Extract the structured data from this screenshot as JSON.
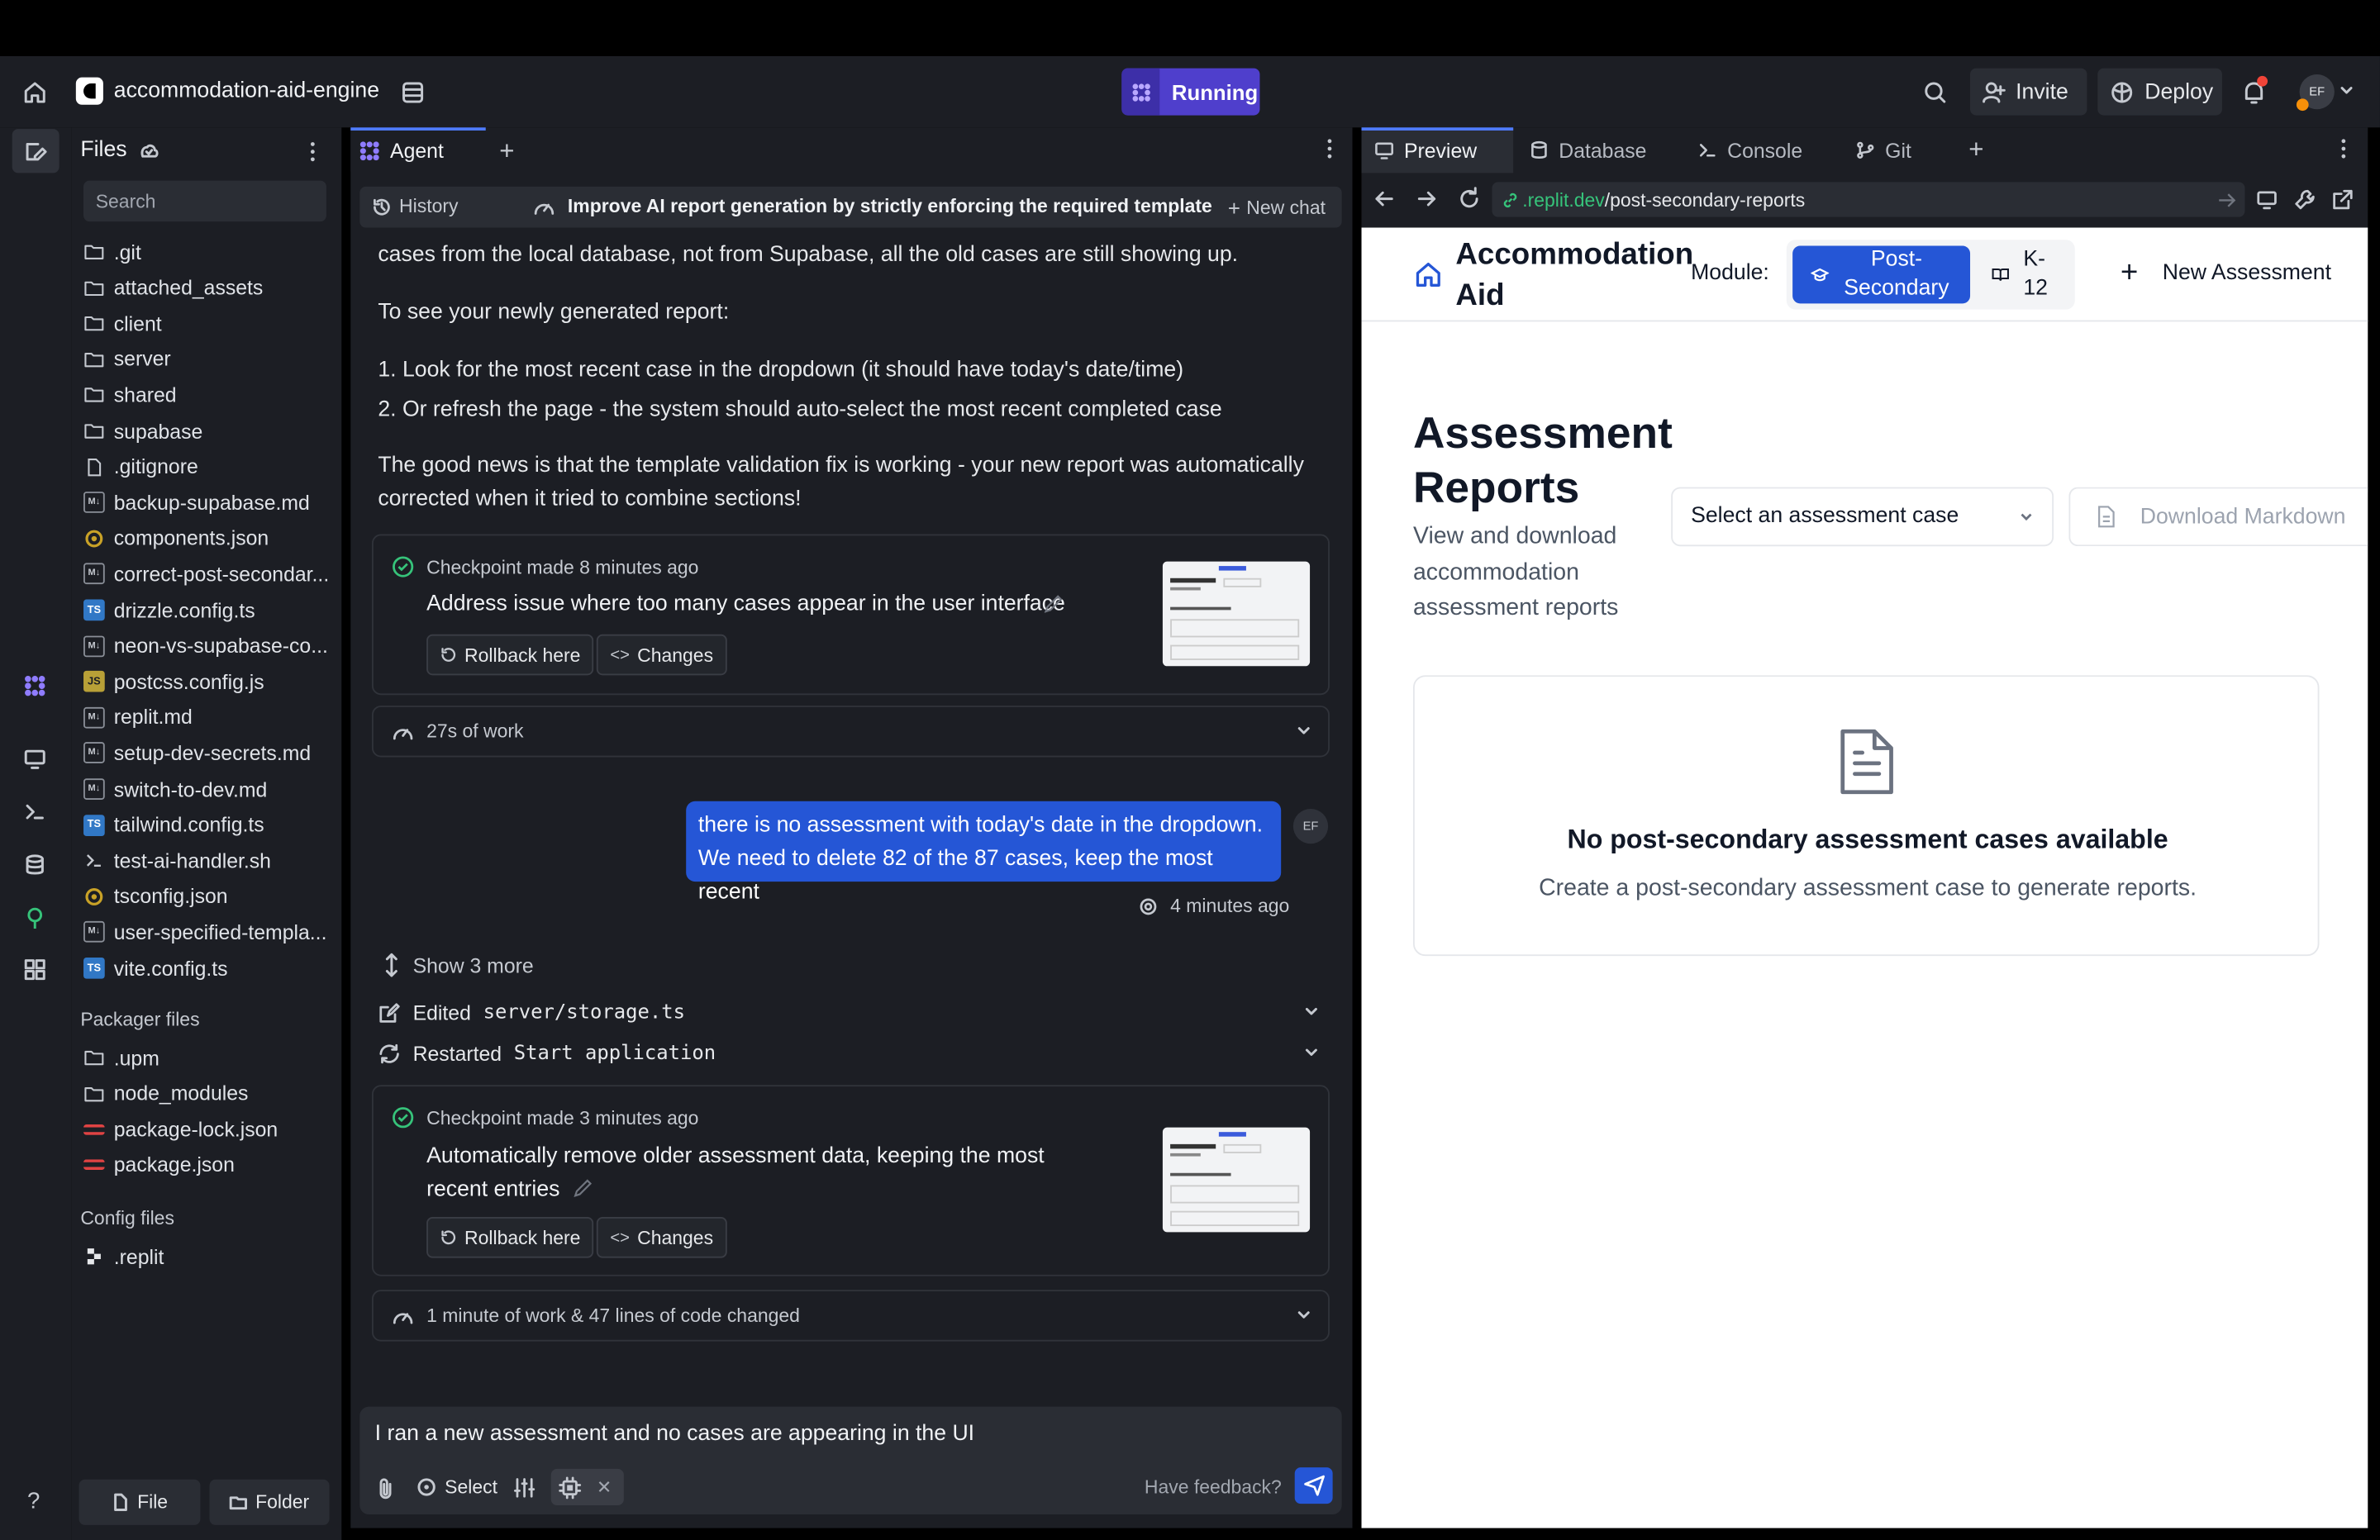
{
  "topbar": {
    "project_name": "accommodation-aid-engine",
    "run_status": "Running",
    "invite_label": "Invite",
    "deploy_label": "Deploy",
    "avatar_initials": "EF"
  },
  "files_panel": {
    "title": "Files",
    "search_placeholder": "Search",
    "items": [
      {
        "name": ".git",
        "type": "folder"
      },
      {
        "name": "attached_assets",
        "type": "folder"
      },
      {
        "name": "client",
        "type": "folder"
      },
      {
        "name": "server",
        "type": "folder"
      },
      {
        "name": "shared",
        "type": "folder"
      },
      {
        "name": "supabase",
        "type": "folder"
      },
      {
        "name": ".gitignore",
        "type": "file"
      },
      {
        "name": "backup-supabase.md",
        "type": "md"
      },
      {
        "name": "components.json",
        "type": "json"
      },
      {
        "name": "correct-post-secondar...",
        "type": "md"
      },
      {
        "name": "drizzle.config.ts",
        "type": "ts"
      },
      {
        "name": "neon-vs-supabase-co...",
        "type": "md"
      },
      {
        "name": "postcss.config.js",
        "type": "js"
      },
      {
        "name": "replit.md",
        "type": "md"
      },
      {
        "name": "setup-dev-secrets.md",
        "type": "md"
      },
      {
        "name": "switch-to-dev.md",
        "type": "md"
      },
      {
        "name": "tailwind.config.ts",
        "type": "ts"
      },
      {
        "name": "test-ai-handler.sh",
        "type": "sh"
      },
      {
        "name": "tsconfig.json",
        "type": "json"
      },
      {
        "name": "user-specified-templa...",
        "type": "md"
      },
      {
        "name": "vite.config.ts",
        "type": "ts"
      }
    ],
    "packager_title": "Packager files",
    "packager_items": [
      {
        "name": ".upm",
        "type": "folder"
      },
      {
        "name": "node_modules",
        "type": "folder"
      },
      {
        "name": "package-lock.json",
        "type": "npm"
      },
      {
        "name": "package.json",
        "type": "npm"
      }
    ],
    "config_title": "Config files",
    "config_items": [
      {
        "name": ".replit",
        "type": "replit"
      }
    ],
    "file_button": "File",
    "folder_button": "Folder"
  },
  "agent": {
    "tab_label": "Agent",
    "history_label": "History",
    "chat_title": "Improve AI report generation by strictly enforcing the required template",
    "new_chat_label": "New chat",
    "message_top": "cases from the local database, not from Supabase, all the old cases are still showing up.",
    "message_intro": "To see your newly generated report:",
    "message_step1": "1. Look for the most recent case in the dropdown (it should have today's date/time)",
    "message_step2": "2. Or refresh the page - the system should auto-select the most recent completed case",
    "message_good_news": "The good news is that the template validation fix is working - your new report was automatically corrected when it tried to combine sections!",
    "checkpoint1": {
      "time": "Checkpoint made 8 minutes ago",
      "title": "Address issue where too many cases appear in the user interface",
      "rollback": "Rollback here",
      "changes": "Changes"
    },
    "work1": "27s of work",
    "user_message": "there is no assessment with today's date in the dropdown. We need to delete 82 of the 87 cases, keep the most recent",
    "user_initials": "EF",
    "user_message_time": "4 minutes ago",
    "show_more": "Show 3 more",
    "edited_label": "Edited",
    "edited_file": "server/storage.ts",
    "restarted_label": "Restarted",
    "restarted_target": "Start application",
    "checkpoint2": {
      "time": "Checkpoint made 3 minutes ago",
      "title": "Automatically remove older assessment data, keeping the most recent entries",
      "rollback": "Rollback here",
      "changes": "Changes"
    },
    "work2": "1 minute of work & 47 lines of code changed",
    "input_value": "I ran a new assessment and no cases are appearing in the UI",
    "select_label": "Select",
    "feedback_label": "Have feedback?"
  },
  "preview": {
    "tabs": [
      "Preview",
      "Database",
      "Console",
      "Git"
    ],
    "url_domain": ".replit.dev",
    "url_path": "/post-secondary-reports",
    "app": {
      "brand_line1": "Accommodation",
      "brand_line2": "Aid",
      "module_label": "Module:",
      "module_active_line1": "Post-",
      "module_active_line2": "Secondary",
      "module_other_line1": "K-",
      "module_other_line2": "12",
      "new_assessment": "New Assessment",
      "page_title_line1": "Assessment",
      "page_title_line2": "Reports",
      "subtitle": "View and download accommodation assessment reports",
      "select_placeholder": "Select an assessment case",
      "download_label": "Download Markdown",
      "empty_title": "No post-secondary assessment cases available",
      "empty_desc": "Create a post-secondary assessment case to generate reports."
    }
  }
}
